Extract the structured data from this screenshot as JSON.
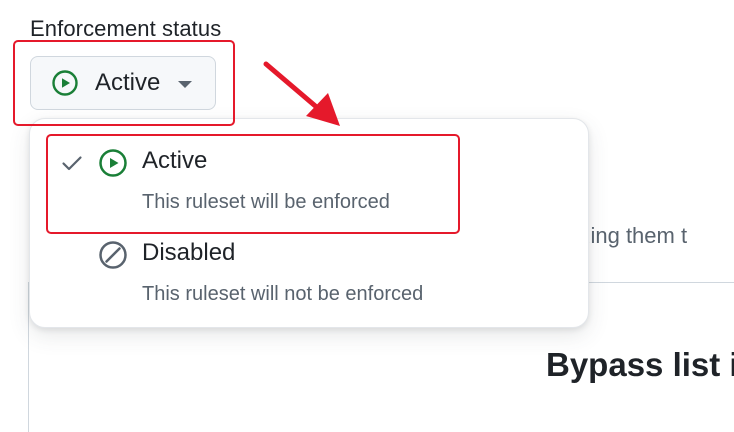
{
  "field": {
    "label": "Enforcement status"
  },
  "status_button": {
    "label": "Active",
    "icon": "play-circle-icon",
    "caret_icon": "triangle-down-icon"
  },
  "menu": {
    "items": [
      {
        "title": "Active",
        "description": "This ruleset will be enforced",
        "icon": "play-circle-icon",
        "selected": true
      },
      {
        "title": "Disabled",
        "description": "This ruleset will not be enforced",
        "icon": "circle-slash-icon",
        "selected": false
      }
    ]
  },
  "background": {
    "partial_text": "dding them t",
    "partial_heading": "Bypass list is"
  },
  "colors": {
    "active_green": "#1a7f37",
    "muted_icon": "#59636e",
    "annotation_red": "#e5192b",
    "button_bg": "#f6f8fa"
  }
}
